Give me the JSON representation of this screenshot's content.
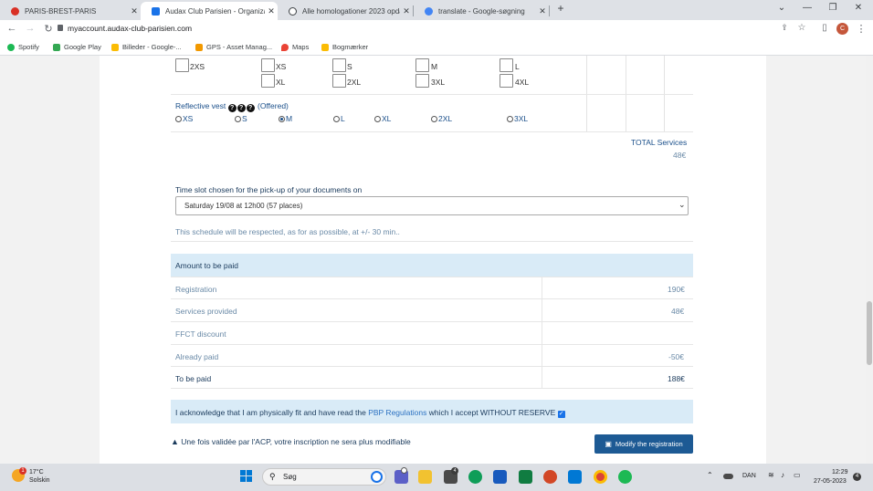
{
  "browser": {
    "tabs": [
      {
        "label": "PARIS-BREST-PARIS",
        "color": "#d93025"
      },
      {
        "label": "Audax Club Parisien - Organizati",
        "color": "#1a73e8"
      },
      {
        "label": "Alle homologationer 2023 opdat",
        "color": "#3c4043"
      },
      {
        "label": "translate - Google-søgning",
        "color": "#4285f4"
      }
    ],
    "new_tab": "+",
    "close_glyph": "✕",
    "url": "myaccount.audax-club-parisien.com",
    "bookmarks": [
      {
        "label": "Spotify",
        "color": "#1db954"
      },
      {
        "label": "Google Play",
        "color": "#34a853"
      },
      {
        "label": "Billeder - Google-...",
        "color": "#fbbc04"
      },
      {
        "label": "GPS - Asset Manag...",
        "color": "#f29900"
      },
      {
        "label": "Maps",
        "color": "#ea4335"
      },
      {
        "label": "Bogmærker",
        "color": "#fbbc04"
      }
    ],
    "profile_initial": "C"
  },
  "sizes_row1": [
    "2XS",
    "XS",
    "S",
    "M",
    "L"
  ],
  "sizes_row2": [
    "XL",
    "2XL",
    "3XL",
    "4XL"
  ],
  "vest": {
    "label": "Reflective vest",
    "offered": "(Offered)",
    "options": [
      "XS",
      "S",
      "M",
      "L",
      "XL",
      "2XL",
      "3XL"
    ],
    "selected": "M"
  },
  "total": {
    "label": "TOTAL Services",
    "value": "48€"
  },
  "timeslot": {
    "label": "Time slot chosen for the pick-up of your documents on",
    "value": "Saturday 19/08 at 12h00 (57 places)",
    "note": "This schedule will be respected, as for as possible, at +/- 30 min.."
  },
  "amount": {
    "heading": "Amount to be paid",
    "rows": [
      {
        "label": "Registration",
        "value": "190€"
      },
      {
        "label": "Services provided",
        "value": "48€"
      },
      {
        "label": "FFCT discount",
        "value": ""
      },
      {
        "label": "Already paid",
        "value": "-50€"
      },
      {
        "label": "To be paid",
        "value": "188€"
      }
    ]
  },
  "ack": {
    "before": "I acknowledge that I am physically fit and have read the",
    "link": "PBP Regulations",
    "after": "which I accept WITHOUT RESERVE"
  },
  "warning": "Une fois validée par l'ACP, votre inscription ne sera plus modifiable",
  "modify_button": "Modify the registration",
  "taskbar": {
    "weather_temp": "17°C",
    "weather_place": "Solskin",
    "search_placeholder": "Søg",
    "lang": "DAN",
    "time": "12:29",
    "date": "27-05-2023",
    "notif_count": "4"
  }
}
